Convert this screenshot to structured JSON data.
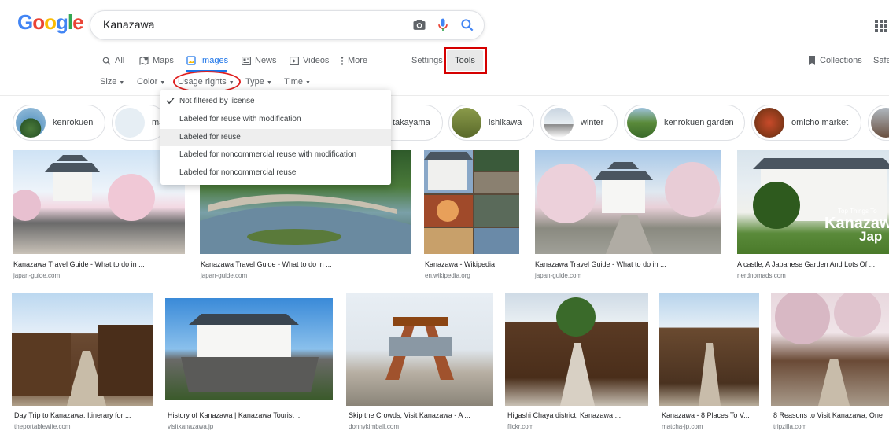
{
  "logo": {
    "G": "G",
    "o1": "o",
    "o2": "o",
    "g": "g",
    "l": "l",
    "e": "e"
  },
  "search": {
    "query": "Kanazawa"
  },
  "tabs": [
    {
      "label": "All",
      "icon": "search-icon"
    },
    {
      "label": "Maps",
      "icon": "map-icon"
    },
    {
      "label": "Images",
      "icon": "image-icon",
      "active": true
    },
    {
      "label": "News",
      "icon": "newspaper-icon"
    },
    {
      "label": "Videos",
      "icon": "play-icon"
    },
    {
      "label": "More",
      "icon": "more-vert-icon"
    }
  ],
  "settings_label": "Settings",
  "tools_label": "Tools",
  "collections_label": "Collections",
  "safesearch_label": "Safe",
  "filters": [
    {
      "label": "Size"
    },
    {
      "label": "Color"
    },
    {
      "label": "Usage rights"
    },
    {
      "label": "Type"
    },
    {
      "label": "Time"
    }
  ],
  "usage_dropdown": {
    "items": [
      {
        "label": "Not filtered by license",
        "checked": true
      },
      {
        "label": "Labeled for reuse with modification"
      },
      {
        "label": "Labeled for reuse",
        "highlighted": true
      },
      {
        "label": "Labeled for noncommercial reuse with modification"
      },
      {
        "label": "Labeled for noncommercial reuse"
      }
    ]
  },
  "chips": [
    "kenrokuen",
    "ma",
    "takayama",
    "ishikawa",
    "winter",
    "kenrokuen garden",
    "omicho market"
  ],
  "results_row1": [
    {
      "caption": "Kanazawa Travel Guide - What to do in ...",
      "source": "japan-guide.com"
    },
    {
      "caption": "Kanazawa Travel Guide - What to do in ...",
      "source": "japan-guide.com"
    },
    {
      "caption": "Kanazawa - Wikipedia",
      "source": "en.wikipedia.org"
    },
    {
      "caption": "Kanazawa Travel Guide - What to do in ...",
      "source": "japan-guide.com"
    },
    {
      "caption": "A castle, A Japanese Garden And Lots Of ...",
      "source": "nerdnomads.com",
      "overlay_top": "Top Things To",
      "overlay_main": "Kanazaw",
      "overlay_sub": "Jap"
    }
  ],
  "results_row2": [
    {
      "caption": "Day Trip to Kanazawa: Itinerary for ...",
      "source": "theportablewife.com"
    },
    {
      "caption": "History of Kanazawa | Kanazawa Tourist ...",
      "source": "visitkanazawa.jp"
    },
    {
      "caption": "Skip the Crowds, Visit Kanazawa - A ...",
      "source": "donnykimball.com"
    },
    {
      "caption": "Higashi Chaya district, Kanazawa ...",
      "source": "flickr.com"
    },
    {
      "caption": "Kanazawa - 8 Places To V...",
      "source": "matcha-jp.com"
    },
    {
      "caption": "8 Reasons to Visit Kanazawa, One",
      "source": "tripzilla.com"
    }
  ],
  "colors": {
    "accent": "#1a73e8",
    "annotation_red": "#d50000"
  }
}
